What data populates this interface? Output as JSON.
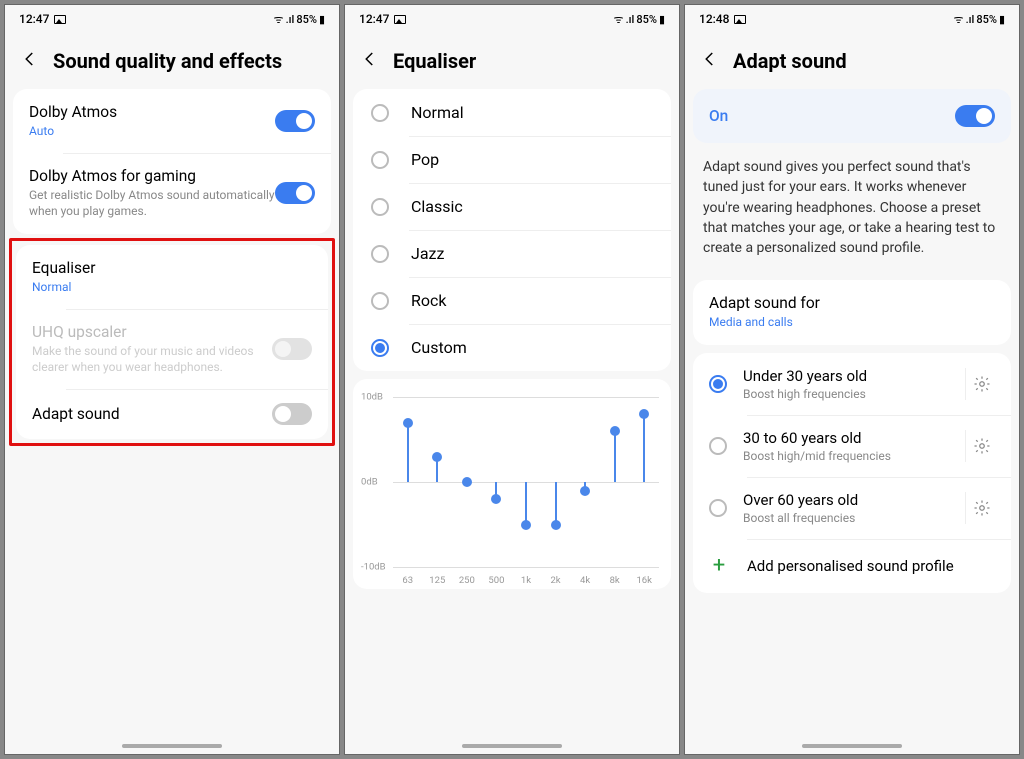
{
  "colors": {
    "accent": "#3a7cf0",
    "red": "#e01010",
    "green": "#2a9d3f"
  },
  "phones": [
    {
      "status": {
        "time": "12:47",
        "battery": "85%"
      },
      "title": "Sound quality and effects",
      "groups": [
        {
          "rows": [
            {
              "title": "Dolby Atmos",
              "sub": "Auto",
              "subBlue": true,
              "toggle": "on"
            },
            {
              "title": "Dolby Atmos for gaming",
              "sub": "Get realistic Dolby Atmos sound automatically when you play games.",
              "toggle": "on"
            }
          ]
        }
      ],
      "highlight_group": {
        "rows": [
          {
            "title": "Equaliser",
            "sub": "Normal",
            "subBlue": true
          },
          {
            "title": "UHQ upscaler",
            "sub": "Make the sound of your music and videos clearer when you wear headphones.",
            "toggle": "disabled",
            "disabled": true
          },
          {
            "title": "Adapt sound",
            "toggle": "off"
          }
        ]
      }
    },
    {
      "status": {
        "time": "12:47",
        "battery": "85%"
      },
      "title": "Equaliser",
      "presets": [
        {
          "label": "Normal",
          "checked": false
        },
        {
          "label": "Pop",
          "checked": false
        },
        {
          "label": "Classic",
          "checked": false
        },
        {
          "label": "Jazz",
          "checked": false
        },
        {
          "label": "Rock",
          "checked": false
        },
        {
          "label": "Custom",
          "checked": true
        }
      ]
    },
    {
      "status": {
        "time": "12:48",
        "battery": "85%"
      },
      "title": "Adapt sound",
      "onLabel": "On",
      "description": "Adapt sound gives you perfect sound that's tuned just for your ears. It works whenever you're wearing headphones. Choose a preset that matches your age, or take a hearing test to create a personalized sound profile.",
      "adaptFor": {
        "title": "Adapt sound for",
        "sub": "Media and calls"
      },
      "ages": [
        {
          "title": "Under 30 years old",
          "sub": "Boost high frequencies",
          "checked": true
        },
        {
          "title": "30 to 60 years old",
          "sub": "Boost high/mid frequencies",
          "checked": false
        },
        {
          "title": "Over 60 years old",
          "sub": "Boost all frequencies",
          "checked": false
        }
      ],
      "addProfile": "Add personalised sound profile"
    }
  ],
  "chart_data": {
    "type": "bar",
    "title": "",
    "xlabel": "",
    "ylabel": "",
    "ylim": [
      -10,
      10
    ],
    "yticks": [
      "10dB",
      "0dB",
      "-10dB"
    ],
    "categories": [
      "63",
      "125",
      "250",
      "500",
      "1k",
      "2k",
      "4k",
      "8k",
      "16k"
    ],
    "values": [
      7,
      3,
      0,
      -2,
      -5,
      -5,
      -1,
      6,
      8
    ]
  }
}
